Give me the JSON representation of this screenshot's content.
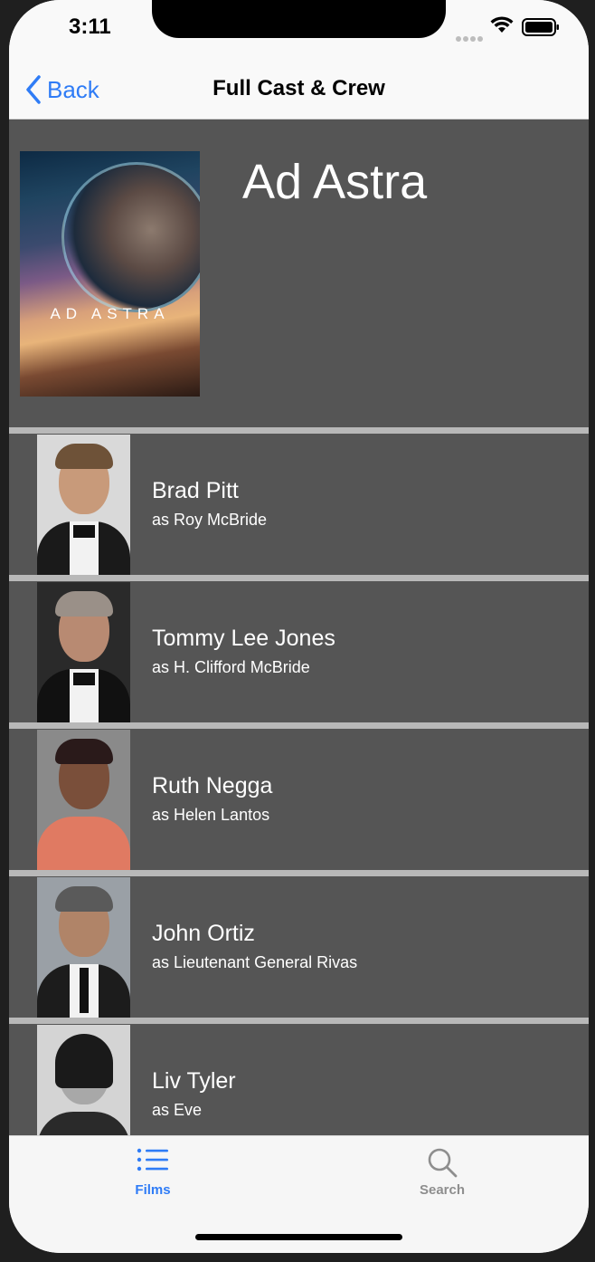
{
  "status_bar": {
    "time": "3:11"
  },
  "nav": {
    "back_label": "Back",
    "title": "Full Cast & Crew"
  },
  "movie": {
    "title": "Ad Astra",
    "poster_text": "AD ASTRA"
  },
  "cast": [
    {
      "name": "Brad Pitt",
      "character": "as Roy McBride"
    },
    {
      "name": "Tommy Lee Jones",
      "character": "as H. Clifford McBride"
    },
    {
      "name": "Ruth Negga",
      "character": "as Helen Lantos"
    },
    {
      "name": "John Ortiz",
      "character": "as Lieutenant General Rivas"
    },
    {
      "name": "Liv Tyler",
      "character": "as Eve"
    }
  ],
  "tab_bar": {
    "tabs": [
      {
        "label": "Films",
        "icon": "list-icon",
        "selected": true
      },
      {
        "label": "Search",
        "icon": "search-icon",
        "selected": false
      }
    ]
  },
  "colors": {
    "accent": "#2f7cf6",
    "content_bg": "#555555",
    "separator": "#b8b8b8"
  }
}
